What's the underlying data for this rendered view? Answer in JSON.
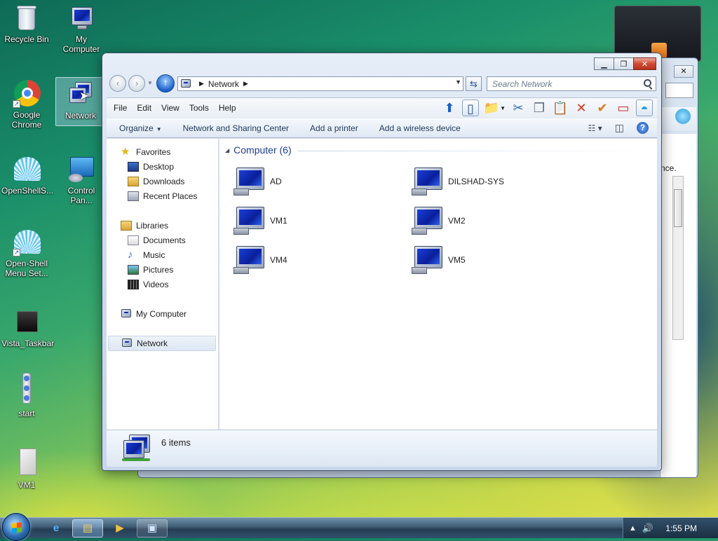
{
  "desktop": {
    "icons": [
      {
        "label": "Recycle Bin"
      },
      {
        "label": "My Computer"
      },
      {
        "label": "Google Chrome"
      },
      {
        "label": "Network"
      },
      {
        "label": "OpenShellS..."
      },
      {
        "label": "Control Pan..."
      },
      {
        "label": "Open-Shell Menu Set..."
      },
      {
        "label": "Vista_Taskbar"
      },
      {
        "label": "start"
      },
      {
        "label": "VM1"
      }
    ]
  },
  "back_window": {
    "partial_text": "nce."
  },
  "window": {
    "address": {
      "location": "Network"
    },
    "search": {
      "placeholder": "Search Network"
    },
    "menu": [
      "File",
      "Edit",
      "View",
      "Tools",
      "Help"
    ],
    "commands": {
      "organize": "Organize",
      "network_center": "Network and Sharing Center",
      "add_printer": "Add a printer",
      "add_wireless": "Add a wireless device"
    },
    "nav": {
      "favorites": "Favorites",
      "desktop": "Desktop",
      "downloads": "Downloads",
      "recent": "Recent Places",
      "libraries": "Libraries",
      "documents": "Documents",
      "music": "Music",
      "pictures": "Pictures",
      "videos": "Videos",
      "mycomputer": "My Computer",
      "network": "Network"
    },
    "group": {
      "title": "Computer (6)"
    },
    "items": [
      "AD",
      "DILSHAD-SYS",
      "VM1",
      "VM2",
      "VM4",
      "VM5"
    ],
    "details": {
      "count": "6 items"
    }
  },
  "taskbar": {
    "clock": "1:55 PM"
  },
  "colors": {
    "accent": "#1e3d8f",
    "close": "#cf4b32"
  }
}
